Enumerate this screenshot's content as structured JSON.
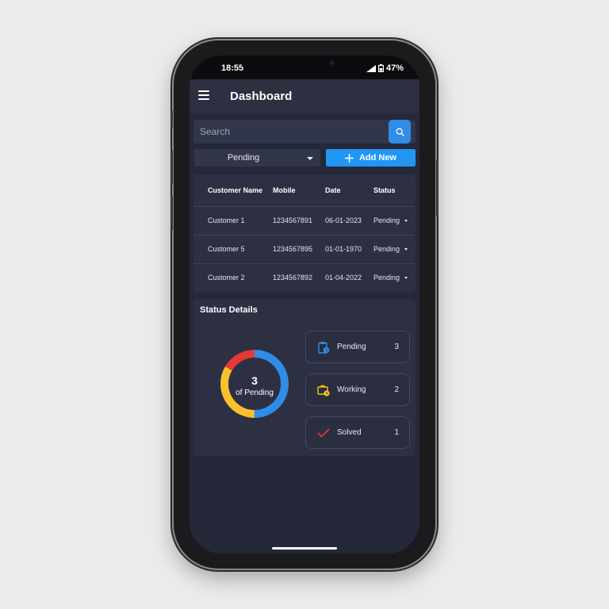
{
  "status_bar": {
    "time": "18:55",
    "battery": "47%"
  },
  "app_bar": {
    "title": "Dashboard"
  },
  "search": {
    "placeholder": "Search"
  },
  "filter": {
    "selected": "Pending"
  },
  "add_button": {
    "label": "Add New"
  },
  "table": {
    "headers": {
      "name": "Customer Name",
      "mobile": "Mobile",
      "date": "Date",
      "status": "Status"
    },
    "rows": [
      {
        "name": "Customer 1",
        "mobile": "1234567891",
        "date": "06-01-2023",
        "status": "Pending"
      },
      {
        "name": "Customer 5",
        "mobile": "1234567895",
        "date": "01-01-1970",
        "status": "Pending"
      },
      {
        "name": "Customer 2",
        "mobile": "1234567892",
        "date": "01-04-2022",
        "status": "Pending"
      }
    ]
  },
  "status_details": {
    "title": "Status Details",
    "donut": {
      "value": "3",
      "label": "of Pending"
    },
    "items": [
      {
        "label": "Pending",
        "count": "3",
        "icon": "clipboard-clock-icon",
        "color": "#2f8de8"
      },
      {
        "label": "Working",
        "count": "2",
        "icon": "briefcase-clock-icon",
        "color": "#f5c518"
      },
      {
        "label": "Solved",
        "count": "1",
        "icon": "checkmark-icon",
        "color": "#e53935"
      }
    ]
  },
  "colors": {
    "accent": "#2196f3",
    "pending": "#2f8de8",
    "working": "#fbc02d",
    "solved": "#e53935",
    "background": "#252838",
    "card": "#2c3042"
  }
}
